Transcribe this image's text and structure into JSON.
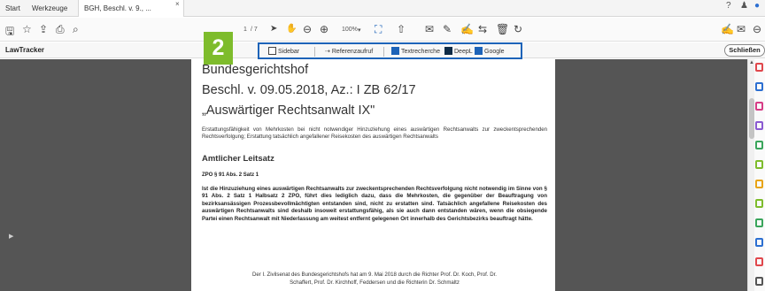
{
  "tabs": {
    "start": "Start",
    "tools": "Werkzeuge",
    "document": "BGH, Beschl. v. 9., ...",
    "close": "×"
  },
  "window": {
    "help": "?",
    "bell": "♟",
    "account": "●"
  },
  "toolbar": {
    "save": "🖫",
    "bookmark": "☆",
    "upload": "⇪",
    "print": "⎙",
    "search": "⌕",
    "page_current": "1",
    "page_total": "/ 7",
    "zoom": "100%",
    "zoom_caret": "▾",
    "right_tools": [
      "✍",
      "✉",
      "⊖"
    ]
  },
  "plugin": {
    "name": "LawTracker",
    "close": "Schließen"
  },
  "plugin_bar": {
    "sidebar": "Sidebar",
    "referenzaufruf": "Referenzaufruf",
    "textrecherche": "Textrecherche",
    "deepl": "DeepL",
    "google": "Google"
  },
  "badge": "2",
  "document": {
    "court": "Bundesgerichtshof",
    "case": "Beschl. v. 09.05.2018, Az.: I ZB 62/17",
    "case_title": "„Auswärtiger Rechtsanwalt IX\"",
    "summary": "Erstattungsfähigkeit von Mehrkosten bei nicht notwendiger Hinzuziehung eines auswärtigen Rechtsanwalts zur zweckentsprechenden Rechtsverfolgung; Erstattung tatsächlich angefallener Reisekosten des auswärtigen Rechtsanwalts",
    "heading": "Amtlicher Leitsatz",
    "norm": "ZPO § 91 Abs. 2 Satz 1",
    "leitsatz": "Ist die Hinzuziehung eines auswärtigen Rechtsanwalts zur zweckentsprechenden Rechtsverfolgung nicht notwendig im Sinne von § 91 Abs. 2 Satz 1 Halbsatz 2 ZPO, führt dies lediglich dazu, dass die Mehrkosten, die gegenüber der Beauftragung von bezirksansässigen Prozessbevollmächtigten entstanden sind, nicht zu erstatten sind. Tatsächlich angefallene Reisekosten des auswärtigen Rechtsanwalts sind deshalb insoweit erstattungsfähig, als sie auch dann entstanden wären, wenn die obsiegende Partei einen Rechtsanwalt mit Niederlassung am weitest entfernt gelegenen Ort innerhalb des Gerichtsbezirks beauftragt hätte.",
    "footer_line1": "Der I. Zivilsenat des Bundesgerichtshofs hat am 9. Mai 2018 durch die Richter Prof. Dr. Koch, Prof. Dr.",
    "footer_line2": "Schaffert, Prof. Dr. Kirchhoff, Feddersen und die Richterin Dr. Schmaltz"
  },
  "colors": {
    "highlight": "#1d63b8",
    "badge": "#7ebc2c",
    "viewer_bg": "#555555"
  }
}
